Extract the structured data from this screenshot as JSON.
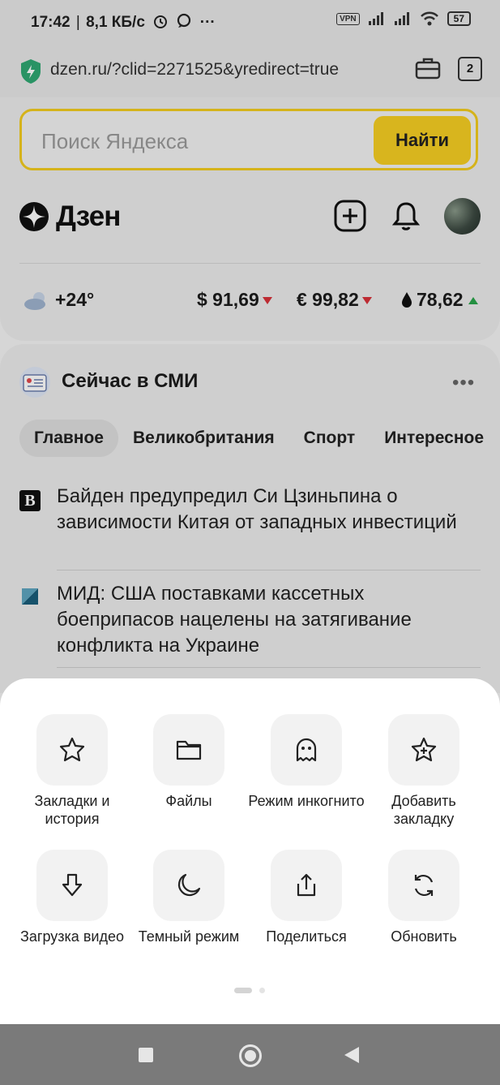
{
  "status_bar": {
    "time": "17:42",
    "speed": "8,1 КБ/с",
    "vpn_label": "VPN",
    "battery": "57"
  },
  "address_bar": {
    "url": "dzen.ru/?clid=2271525&yredirect=true",
    "tabs_count": "2"
  },
  "search": {
    "placeholder": "Поиск Яндекса",
    "button_label": "Найти"
  },
  "brand": {
    "name": "Дзен"
  },
  "rates": {
    "weather": "+24°",
    "usd": "$ 91,69",
    "eur": "€ 99,82",
    "oil": "78,62"
  },
  "news": {
    "section_title": "Сейчас в СМИ",
    "more_label": "•••",
    "tabs": [
      "Главное",
      "Великобритания",
      "Спорт",
      "Интересное"
    ],
    "items": [
      {
        "text": "Байден предупредил Си Цзиньпина о зависимости Китая от западных инвестиций",
        "source_badge": "B"
      },
      {
        "text": "МИД: США поставками кассетных боеприпасов нацелены на затягивание конфликта на Украине"
      }
    ]
  },
  "menu": {
    "tiles": [
      {
        "icon": "star-icon",
        "label": "Закладки и история"
      },
      {
        "icon": "folder-icon",
        "label": "Файлы"
      },
      {
        "icon": "ghost-icon",
        "label": "Режим инкогнито"
      },
      {
        "icon": "star-plus-icon",
        "label": "Добавить закладку"
      },
      {
        "icon": "download-icon",
        "label": "Загрузка видео"
      },
      {
        "icon": "moon-icon",
        "label": "Темный режим"
      },
      {
        "icon": "share-icon",
        "label": "Поделиться"
      },
      {
        "icon": "refresh-icon",
        "label": "Обновить"
      }
    ]
  },
  "colors": {
    "search_accent": "#f6cf23",
    "rate_down": "#d8313a",
    "rate_up": "#2aa44a"
  }
}
